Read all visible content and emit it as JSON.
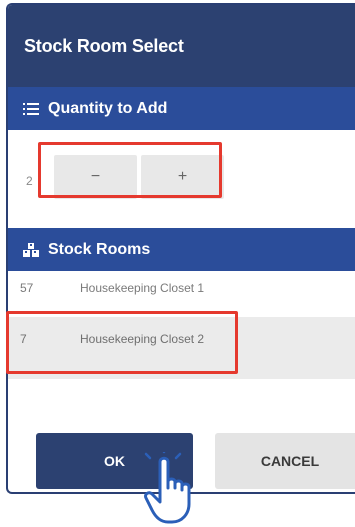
{
  "dialog": {
    "title": "Stock Room Select"
  },
  "quantity_section": {
    "header": "Quantity to Add",
    "icon": "list-icon",
    "value": "2",
    "decrement_label": "−",
    "increment_label": "+"
  },
  "stock_section": {
    "header": "Stock Rooms",
    "icon": "warehouse-icon",
    "items": [
      {
        "number": "57",
        "name": "Housekeeping Closet 1"
      },
      {
        "number": "7",
        "name": "Housekeeping Closet 2"
      }
    ]
  },
  "actions": {
    "ok_label": "OK",
    "cancel_label": "CANCEL"
  },
  "colors": {
    "title_bar": "#2c4171",
    "section_header": "#2b4d9a",
    "highlight": "#e5392e",
    "ok_button": "#2c4171"
  }
}
